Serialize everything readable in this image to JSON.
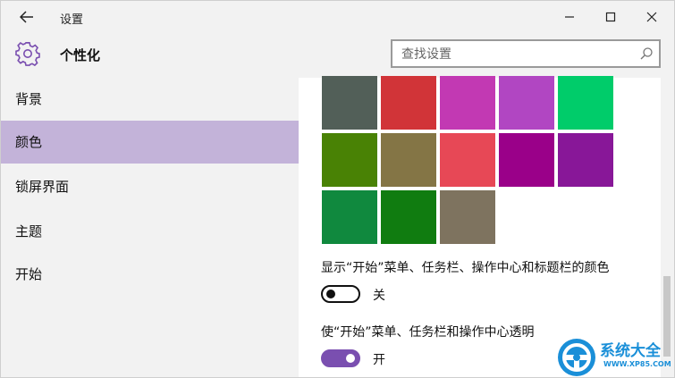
{
  "window": {
    "title": "设置"
  },
  "header": {
    "title": "个性化",
    "search_placeholder": "查找设置"
  },
  "sidebar": {
    "items": [
      {
        "label": "背景",
        "active": false
      },
      {
        "label": "颜色",
        "active": true
      },
      {
        "label": "锁屏界面",
        "active": false
      },
      {
        "label": "主题",
        "active": false
      },
      {
        "label": "开始",
        "active": false
      }
    ]
  },
  "accent_colors": [
    "#525f58",
    "#d13438",
    "#c239b3",
    "#b146c2",
    "#00cc6a",
    "#498205",
    "#847545",
    "#e74856",
    "#9a0089",
    "#881798",
    "#10893e",
    "#107c10",
    "#7e735f"
  ],
  "settings": {
    "show_color": {
      "label": "显示“开始”菜单、任务栏、操作中心和标题栏的颜色",
      "state": "关",
      "on": false
    },
    "transparency": {
      "label": "使“开始”菜单、任务栏和操作中心透明",
      "state": "开",
      "on": true
    }
  },
  "watermark": {
    "name": "系统大全",
    "url": "WWW.XP85.COM"
  },
  "colors": {
    "accent": "#7a4fb0",
    "sidebar_selected": "#c3b3d9",
    "chrome_bg": "#f2f2f2"
  }
}
